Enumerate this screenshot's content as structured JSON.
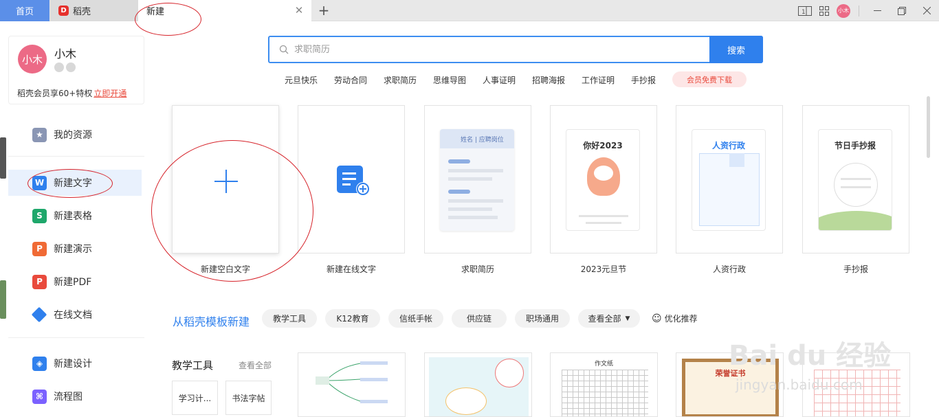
{
  "tabs": {
    "home": "首页",
    "daoke": "稻壳",
    "new": "新建"
  },
  "window": {
    "avatar_text": "小木"
  },
  "profile": {
    "avatar_text": "小木",
    "name": "小木",
    "promo_text": "稻壳会员享60+特权",
    "promo_link": "立即开通"
  },
  "sidebar": {
    "items": [
      {
        "label": "我的资源",
        "icon": "star-icon",
        "color": "#8a96b4"
      },
      {
        "label": "新建文字",
        "icon": "writer-icon",
        "color": "#2f80ed"
      },
      {
        "label": "新建表格",
        "icon": "spreadsheet-icon",
        "color": "#1ea76b"
      },
      {
        "label": "新建演示",
        "icon": "presentation-icon",
        "color": "#f06a35"
      },
      {
        "label": "新建PDF",
        "icon": "pdf-icon",
        "color": "#e94a3c"
      },
      {
        "label": "在线文档",
        "icon": "cloud-doc-icon",
        "color": "#2f80ed"
      },
      {
        "label": "新建设计",
        "icon": "design-icon",
        "color": "#2f80ed"
      },
      {
        "label": "流程图",
        "icon": "flowchart-icon",
        "color": "#7b61ff"
      }
    ]
  },
  "search": {
    "placeholder": "求职简历",
    "button": "搜索"
  },
  "hot_tags": [
    "元旦快乐",
    "劳动合同",
    "求职简历",
    "思维导图",
    "人事证明",
    "招聘海报",
    "工作证明",
    "手抄报"
  ],
  "vip_download": "会员免费下载",
  "cards": [
    {
      "label": "新建空白文字"
    },
    {
      "label": "新建在线文字"
    },
    {
      "label": "求职简历",
      "inner": "姓名 | 应聘岗位"
    },
    {
      "label": "2023元旦节",
      "inner": "你好2023"
    },
    {
      "label": "人资行政",
      "inner": "人资行政"
    },
    {
      "label": "手抄报",
      "inner": "节日手抄报"
    }
  ],
  "template_section": {
    "title": "从稻壳模板新建",
    "chips": [
      "教学工具",
      "K12教育",
      "信纸手帐",
      "供应链",
      "职场通用",
      "查看全部"
    ],
    "optimize": "优化推荐"
  },
  "edu": {
    "title": "教学工具",
    "view_all": "查看全部",
    "items": [
      "学习计...",
      "书法字帖"
    ]
  },
  "thumbs": [
    {
      "inner": ""
    },
    {
      "inner": ""
    },
    {
      "inner": "作文纸"
    },
    {
      "inner": "荣誉证书"
    },
    {
      "inner": ""
    }
  ],
  "watermark": {
    "main": "Bai du 经验",
    "sub": "jingyan.baidu.com"
  },
  "colors": {
    "accent": "#2f80ed",
    "home_tab": "#5b8fe8",
    "annotation": "#d6232a",
    "promo_link": "#e94a3c"
  }
}
